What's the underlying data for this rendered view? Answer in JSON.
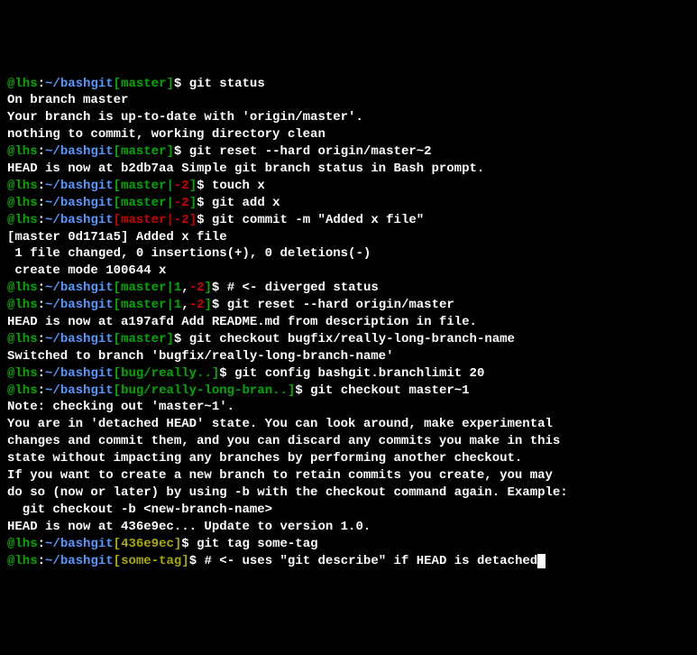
{
  "user": "lhs",
  "path": "~/bashgit",
  "lines": [
    {
      "type": "prompt",
      "bracket": "green",
      "branch": "master",
      "cmd": "git status"
    },
    {
      "type": "out",
      "text": "On branch master"
    },
    {
      "type": "out",
      "text": "Your branch is up-to-date with 'origin/master'."
    },
    {
      "type": "out",
      "text": "nothing to commit, working directory clean"
    },
    {
      "type": "prompt",
      "bracket": "green",
      "branch": "master",
      "cmd": "git reset --hard origin/master~2"
    },
    {
      "type": "out",
      "text": "HEAD is now at b2db7aa Simple git branch status in Bash prompt."
    },
    {
      "type": "prompt",
      "bracket": "green",
      "branch": "master",
      "status": "|-2",
      "statusColor": "behind",
      "cmd": "touch x"
    },
    {
      "type": "prompt",
      "bracket": "green",
      "branch": "master",
      "status": "|-2",
      "statusColor": "behind",
      "cmd": "git add x"
    },
    {
      "type": "prompt",
      "bracket": "red",
      "branch": "master",
      "branchColor": "red",
      "status": "|-2",
      "statusColor": "behind",
      "cmd": "git commit -m \"Added x file\""
    },
    {
      "type": "out",
      "text": "[master 0d171a5] Added x file"
    },
    {
      "type": "out",
      "text": " 1 file changed, 0 insertions(+), 0 deletions(-)"
    },
    {
      "type": "out",
      "text": " create mode 100644 x"
    },
    {
      "type": "prompt",
      "bracket": "green",
      "branch": "master",
      "diverged": true,
      "ahead": "1",
      "behind": "-2",
      "cmd": "# <- diverged status"
    },
    {
      "type": "prompt",
      "bracket": "green",
      "branch": "master",
      "diverged": true,
      "ahead": "1",
      "behind": "-2",
      "cmd": "git reset --hard origin/master"
    },
    {
      "type": "out",
      "text": "HEAD is now at a197afd Add README.md from description in file."
    },
    {
      "type": "prompt",
      "bracket": "green",
      "branch": "master",
      "cmd": "git checkout bugfix/really-long-branch-name"
    },
    {
      "type": "out",
      "text": "Switched to branch 'bugfix/really-long-branch-name'"
    },
    {
      "type": "prompt",
      "bracket": "green",
      "branch": "bug/really..",
      "cmd": "git config bashgit.branchlimit 20"
    },
    {
      "type": "prompt",
      "bracket": "green",
      "branch": "bug/really-long-bran..",
      "cmd": "git checkout master~1"
    },
    {
      "type": "out",
      "text": "Note: checking out 'master~1'."
    },
    {
      "type": "out",
      "text": ""
    },
    {
      "type": "out",
      "text": "You are in 'detached HEAD' state. You can look around, make experimental"
    },
    {
      "type": "out",
      "text": "changes and commit them, and you can discard any commits you make in this"
    },
    {
      "type": "out",
      "text": "state without impacting any branches by performing another checkout."
    },
    {
      "type": "out",
      "text": ""
    },
    {
      "type": "out",
      "text": "If you want to create a new branch to retain commits you create, you may"
    },
    {
      "type": "out",
      "text": "do so (now or later) by using -b with the checkout command again. Example:"
    },
    {
      "type": "out",
      "text": ""
    },
    {
      "type": "out",
      "text": "  git checkout -b <new-branch-name>"
    },
    {
      "type": "out",
      "text": ""
    },
    {
      "type": "out",
      "text": "HEAD is now at 436e9ec... Update to version 1.0."
    },
    {
      "type": "prompt",
      "bracket": "yellow",
      "branch": "436e9ec",
      "branchColor": "yellow",
      "cmd": "git tag some-tag"
    },
    {
      "type": "prompt",
      "bracket": "yellow",
      "branch": "some-tag",
      "branchColor": "yellow",
      "cmd": "# <- uses \"git describe\" if HEAD is detached",
      "cursor": true
    }
  ]
}
